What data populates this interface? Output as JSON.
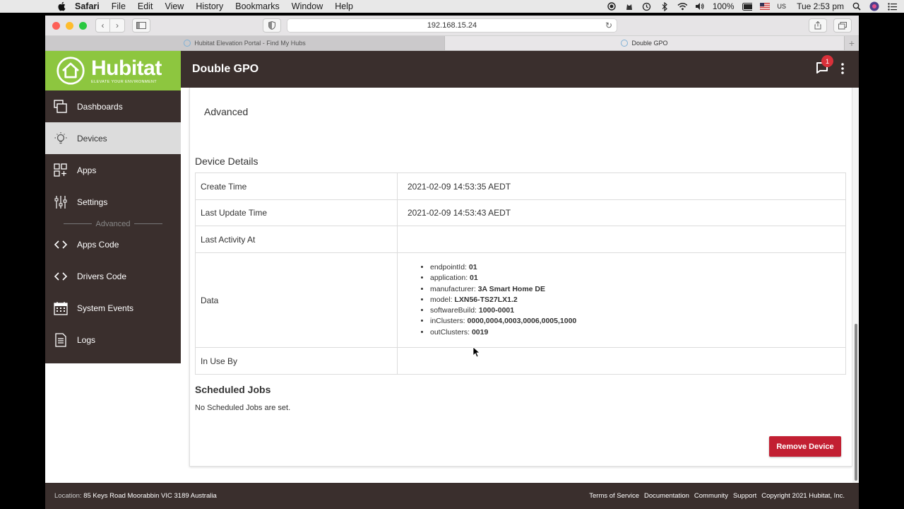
{
  "menubar": {
    "items": [
      "Safari",
      "File",
      "Edit",
      "View",
      "History",
      "Bookmarks",
      "Window",
      "Help"
    ],
    "battery": "100%",
    "input_source": "US",
    "clock": "Tue 2:53 pm"
  },
  "browser": {
    "url": "192.168.15.24",
    "tabs": [
      {
        "title": "Hubitat Elevation Portal - Find My Hubs"
      },
      {
        "title": "Double GPO"
      }
    ]
  },
  "app": {
    "brand_name": "Hubitat",
    "brand_tagline": "ELEVATE YOUR ENVIRONMENT",
    "page_title": "Double GPO",
    "notification_count": "1",
    "colors": {
      "brand_green": "#8dc63f",
      "header_brown": "#3a2f2d",
      "danger_red": "#c21f32"
    }
  },
  "sidebar": {
    "items": [
      {
        "label": "Dashboards",
        "icon": "dashboards-icon"
      },
      {
        "label": "Devices",
        "icon": "lightbulb-icon"
      },
      {
        "label": "Apps",
        "icon": "apps-grid-icon"
      },
      {
        "label": "Settings",
        "icon": "sliders-icon"
      }
    ],
    "divider_label": "Advanced",
    "advanced_items": [
      {
        "label": "Apps Code",
        "icon": "code-icon"
      },
      {
        "label": "Drivers Code",
        "icon": "code-icon"
      },
      {
        "label": "System Events",
        "icon": "calendar-icon"
      },
      {
        "label": "Logs",
        "icon": "document-icon"
      }
    ]
  },
  "content": {
    "advanced_label": "Advanced",
    "device_details_title": "Device Details",
    "rows": {
      "create_time": {
        "label": "Create Time",
        "value": "2021-02-09 14:53:35 AEDT"
      },
      "last_update": {
        "label": "Last Update Time",
        "value": "2021-02-09 14:53:43 AEDT"
      },
      "last_activity": {
        "label": "Last Activity At",
        "value": ""
      },
      "data": {
        "label": "Data"
      },
      "in_use_by": {
        "label": "In Use By",
        "value": ""
      }
    },
    "data_items": [
      {
        "key": "endpointId: ",
        "value": "01"
      },
      {
        "key": "application: ",
        "value": "01"
      },
      {
        "key": "manufacturer: ",
        "value": "3A Smart Home DE"
      },
      {
        "key": "model: ",
        "value": "LXN56-TS27LX1.2"
      },
      {
        "key": "softwareBuild: ",
        "value": "1000-0001"
      },
      {
        "key": "inClusters: ",
        "value": "0000,0004,0003,0006,0005,1000"
      },
      {
        "key": "outClusters: ",
        "value": "0019"
      }
    ],
    "scheduled_jobs_title": "Scheduled Jobs",
    "scheduled_jobs_text": "No Scheduled Jobs are set.",
    "remove_button": "Remove Device"
  },
  "footer": {
    "location_label": "Location: ",
    "location_value": "85 Keys Road Moorabbin VIC 3189 Australia",
    "links": [
      "Terms of Service",
      "Documentation",
      "Community",
      "Support"
    ],
    "copyright": "Copyright 2021 Hubitat, Inc."
  }
}
